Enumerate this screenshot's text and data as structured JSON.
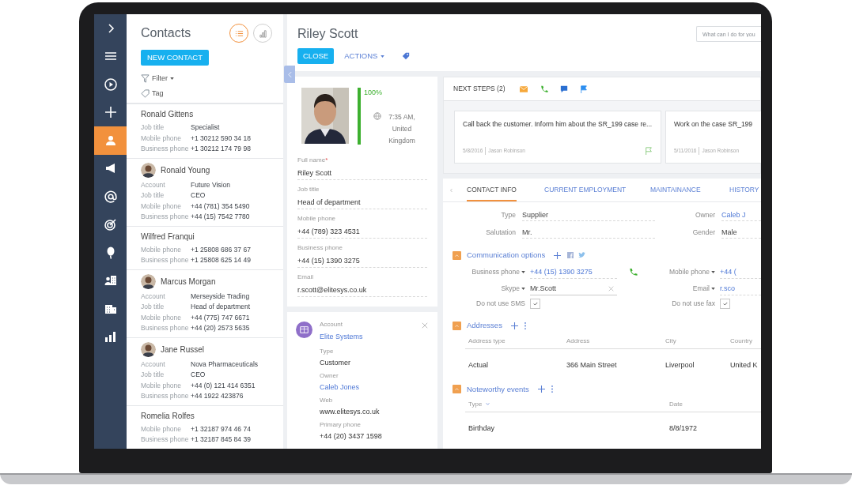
{
  "nav": {
    "items": [
      {
        "kind": "expand",
        "selected": false
      },
      {
        "kind": "menu",
        "selected": false
      },
      {
        "kind": "play",
        "selected": false
      },
      {
        "kind": "plus",
        "selected": false
      },
      {
        "kind": "contact",
        "selected": true
      },
      {
        "kind": "campaign",
        "selected": false
      },
      {
        "kind": "email",
        "selected": false
      },
      {
        "kind": "target",
        "selected": false
      },
      {
        "kind": "balloon",
        "selected": false
      },
      {
        "kind": "people",
        "selected": false
      },
      {
        "kind": "building",
        "selected": false
      },
      {
        "kind": "chart",
        "selected": false
      }
    ]
  },
  "contacts": {
    "title": "Contacts",
    "new_button": "NEW CONTACT",
    "filter": "Filter",
    "tag": "Tag",
    "views": [
      {
        "kind": "list",
        "selected": true
      },
      {
        "kind": "chart",
        "selected": false
      }
    ],
    "items": [
      {
        "name": "Ronald Gittens",
        "has_photo": false,
        "fields": [
          {
            "label": "Job title",
            "value": "Specialist"
          },
          {
            "label": "Mobile phone",
            "value": "+1 30212 590 34 18"
          },
          {
            "label": "Business phone",
            "value": "+1 30212 174 79 98"
          }
        ]
      },
      {
        "name": "Ronald Young",
        "has_photo": true,
        "fields": [
          {
            "label": "Account",
            "value": "Future Vision"
          },
          {
            "label": "Job title",
            "value": "CEO"
          },
          {
            "label": "Mobile phone",
            "value": "+44 (781) 354 5490"
          },
          {
            "label": "Business phone",
            "value": "+44 (15) 7542 7780"
          }
        ]
      },
      {
        "name": "Wilfred Franqui",
        "has_photo": false,
        "fields": [
          {
            "label": "Mobile phone",
            "value": "+1 25808 686 37 67"
          },
          {
            "label": "Business phone",
            "value": "+1 25808 625 14 49"
          }
        ]
      },
      {
        "name": "Marcus Morgan",
        "has_photo": true,
        "fields": [
          {
            "label": "Account",
            "value": "Merseyside Trading"
          },
          {
            "label": "Job title",
            "value": "Head of department"
          },
          {
            "label": "Mobile phone",
            "value": "+44 (775) 747 6671"
          },
          {
            "label": "Business phone",
            "value": "+44 (20) 2573 5635"
          }
        ]
      },
      {
        "name": "Jane Russel",
        "has_photo": true,
        "fields": [
          {
            "label": "Account",
            "value": "Nova Pharmaceuticals"
          },
          {
            "label": "Job title",
            "value": "CEO"
          },
          {
            "label": "Mobile phone",
            "value": "+44 (0) 121 414 6351"
          },
          {
            "label": "Business phone",
            "value": "+44 1922 423876"
          }
        ]
      },
      {
        "name": "Romelia Rolfes",
        "has_photo": false,
        "fields": [
          {
            "label": "Mobile phone",
            "value": "+1 32187 974 46 74"
          },
          {
            "label": "Business phone",
            "value": "+1 32187 845 84 39"
          }
        ]
      }
    ]
  },
  "record": {
    "title": "Riley Scott",
    "close_button": "CLOSE",
    "actions_button": "ACTIONS",
    "search": {
      "placeholder": "What can I do for you"
    }
  },
  "profile": {
    "completeness": "100%",
    "level": 1,
    "local_time": "7:35 AM, United Kingdom",
    "fields": [
      {
        "label": "Full name",
        "mark": "*",
        "value": "Riley Scott"
      },
      {
        "label": "Job title",
        "value": "Head of department"
      },
      {
        "label": "Mobile phone",
        "value": "+44 (789) 323 4531"
      },
      {
        "label": "Business phone",
        "value": "+44 (15) 1390 3275"
      },
      {
        "label": "Email",
        "value": "r.scott@elitesys.co.uk"
      }
    ]
  },
  "account_card": {
    "label": "Account",
    "value": "Elite Systems",
    "fields": [
      {
        "label": "Type",
        "value": "Customer",
        "link": false
      },
      {
        "label": "Owner",
        "value": "Caleb Jones",
        "link": true
      },
      {
        "label": "Web",
        "value": "www.elitesys.co.uk",
        "link": false
      },
      {
        "label": "Primary phone",
        "value": "+44 (20) 3437 1598",
        "link": false
      }
    ]
  },
  "next_steps": {
    "title": "NEXT STEPS (2)",
    "items": [
      {
        "text": "Call back the customer. Inform him about the SR_199 case re...",
        "date": "5/8/2016",
        "author": "Jason Robinson",
        "flagged": true
      },
      {
        "text": "Work on the case SR_199",
        "date": "5/11/2016",
        "author": "Jason Robinson",
        "flagged": false
      }
    ]
  },
  "tabs": [
    {
      "label": "CONTACT INFO",
      "selected": true
    },
    {
      "label": "CURRENT EMPLOYMENT",
      "selected": false
    },
    {
      "label": "MAINTAINANCE",
      "selected": false
    },
    {
      "label": "HISTORY",
      "selected": false
    }
  ],
  "general_fields": [
    {
      "label": "Type",
      "value": "Supplier",
      "link": false
    },
    {
      "label": "Owner",
      "value": "Caleb J",
      "link": true
    },
    {
      "label": "Salutation",
      "value": "Mr.",
      "link": false
    },
    {
      "label": "Gender",
      "value": "Male",
      "link": false
    }
  ],
  "communication": {
    "title": "Communication options",
    "expanded": true,
    "fields": [
      {
        "kind": "phone",
        "label": "Business phone",
        "value": "+44 (15) 1390 3275"
      },
      {
        "kind": "link",
        "label": "Mobile phone",
        "value": "+44 ("
      },
      {
        "kind": "text",
        "label": "Skype",
        "value": "Mr.Scott"
      },
      {
        "kind": "link",
        "label": "Email",
        "value": "r.sco"
      }
    ],
    "checkboxes": [
      {
        "label": "Do not use SMS",
        "checked": true
      },
      {
        "label": "Do not use fax",
        "checked": true
      }
    ]
  },
  "addresses": {
    "title": "Addresses",
    "expanded": true,
    "columns": [
      "Address type",
      "Address",
      "City",
      "Country"
    ],
    "rows": [
      [
        "Actual",
        "366 Main Street",
        "Liverpool",
        "United K"
      ]
    ]
  },
  "events": {
    "title": "Noteworthy events",
    "expanded": true,
    "columns": [
      "Type",
      "Date"
    ],
    "rows": [
      [
        "Birthday",
        "8/8/1972"
      ]
    ]
  }
}
